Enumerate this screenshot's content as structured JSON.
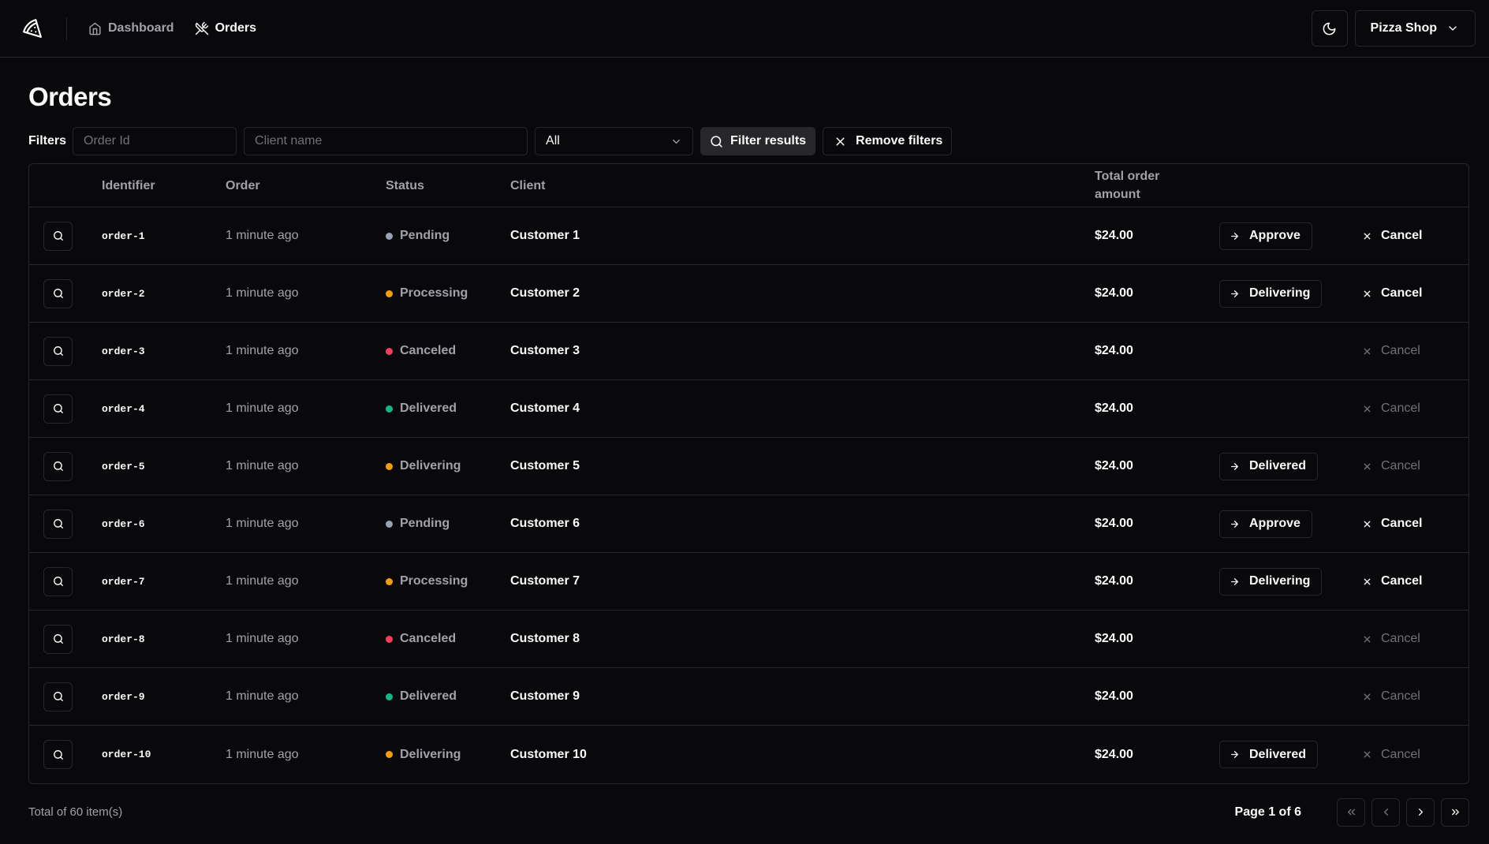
{
  "header": {
    "logo_icon": "pizza-icon",
    "nav": [
      {
        "label": "Dashboard",
        "icon": "home-icon",
        "active": false
      },
      {
        "label": "Orders",
        "icon": "utensils-crossed-icon",
        "active": true
      }
    ],
    "theme_icon": "moon-icon",
    "store_name": "Pizza Shop"
  },
  "page": {
    "title": "Orders"
  },
  "filters": {
    "label": "Filters",
    "order_id_placeholder": "Order Id",
    "client_placeholder": "Client name",
    "status_value": "All",
    "filter_button": "Filter results",
    "remove_button": "Remove filters"
  },
  "table": {
    "headers": {
      "identifier": "Identifier",
      "order": "Order",
      "status": "Status",
      "client": "Client",
      "total": "Total order amount"
    },
    "rows": [
      {
        "id": "order-1",
        "time": "1 minute ago",
        "status": "Pending",
        "client": "Customer 1",
        "total": "$24.00",
        "action": "Approve",
        "cancel": "Cancel",
        "cancel_enabled": true
      },
      {
        "id": "order-2",
        "time": "1 minute ago",
        "status": "Processing",
        "client": "Customer 2",
        "total": "$24.00",
        "action": "Delivering",
        "cancel": "Cancel",
        "cancel_enabled": true
      },
      {
        "id": "order-3",
        "time": "1 minute ago",
        "status": "Canceled",
        "client": "Customer 3",
        "total": "$24.00",
        "action": "",
        "cancel": "Cancel",
        "cancel_enabled": false
      },
      {
        "id": "order-4",
        "time": "1 minute ago",
        "status": "Delivered",
        "client": "Customer 4",
        "total": "$24.00",
        "action": "",
        "cancel": "Cancel",
        "cancel_enabled": false
      },
      {
        "id": "order-5",
        "time": "1 minute ago",
        "status": "Delivering",
        "client": "Customer 5",
        "total": "$24.00",
        "action": "Delivered",
        "cancel": "Cancel",
        "cancel_enabled": false
      },
      {
        "id": "order-6",
        "time": "1 minute ago",
        "status": "Pending",
        "client": "Customer 6",
        "total": "$24.00",
        "action": "Approve",
        "cancel": "Cancel",
        "cancel_enabled": true
      },
      {
        "id": "order-7",
        "time": "1 minute ago",
        "status": "Processing",
        "client": "Customer 7",
        "total": "$24.00",
        "action": "Delivering",
        "cancel": "Cancel",
        "cancel_enabled": true
      },
      {
        "id": "order-8",
        "time": "1 minute ago",
        "status": "Canceled",
        "client": "Customer 8",
        "total": "$24.00",
        "action": "",
        "cancel": "Cancel",
        "cancel_enabled": false
      },
      {
        "id": "order-9",
        "time": "1 minute ago",
        "status": "Delivered",
        "client": "Customer 9",
        "total": "$24.00",
        "action": "",
        "cancel": "Cancel",
        "cancel_enabled": false
      },
      {
        "id": "order-10",
        "time": "1 minute ago",
        "status": "Delivering",
        "client": "Customer 10",
        "total": "$24.00",
        "action": "Delivered",
        "cancel": "Cancel",
        "cancel_enabled": false
      }
    ]
  },
  "status_colors": {
    "Pending": "#94a3b8",
    "Processing": "#f59e0b",
    "Canceled": "#f43f5e",
    "Delivered": "#10b981",
    "Delivering": "#f59e0b"
  },
  "pagination": {
    "total_text": "Total of 60 item(s)",
    "page_text": "Page 1 of 6"
  }
}
